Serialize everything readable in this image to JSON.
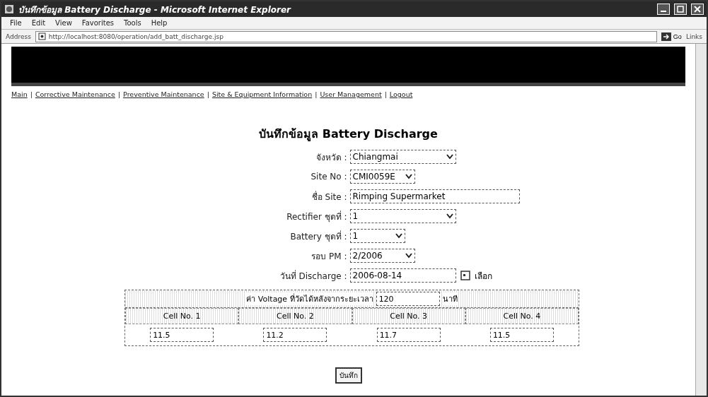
{
  "window": {
    "title": "บันทึกข้อมูล Battery Discharge - Microsoft Internet Explorer"
  },
  "menu": [
    "File",
    "Edit",
    "View",
    "Favorites",
    "Tools",
    "Help"
  ],
  "address": {
    "label": "Address",
    "url": "http://localhost:8080/operation/add_batt_discharge.jsp",
    "go": "Go",
    "links": "Links"
  },
  "nav": [
    {
      "kind": "link",
      "text": "Main"
    },
    {
      "kind": "separator",
      "text": "|"
    },
    {
      "kind": "link",
      "text": "Corrective Maintenance"
    },
    {
      "kind": "separator",
      "text": "|"
    },
    {
      "kind": "link",
      "text": "Preventive Maintenance"
    },
    {
      "kind": "separator",
      "text": "|"
    },
    {
      "kind": "link",
      "text": "Site & Equipment Information"
    },
    {
      "kind": "separator",
      "text": "|"
    },
    {
      "kind": "link",
      "text": "User Management"
    },
    {
      "kind": "separator",
      "text": "|"
    },
    {
      "kind": "link",
      "text": "Logout"
    }
  ],
  "form": {
    "title": "บันทึกข้อมูล Battery Discharge",
    "fields": [
      {
        "kind": "select",
        "label": "จังหวัด :",
        "value": "Chiangmai"
      },
      {
        "kind": "select",
        "label": "Site No :",
        "value": "CMI0059E"
      },
      {
        "kind": "text",
        "label": "ชื่อ Site :",
        "value": "Rimping Supermarket"
      },
      {
        "kind": "select",
        "label": "Rectifier ชุดที่ :",
        "value": "1"
      },
      {
        "kind": "select",
        "label": "Battery ชุดที่ :",
        "value": "1"
      },
      {
        "kind": "select",
        "label": "รอบ PM :",
        "value": "2/2006"
      },
      {
        "kind": "date",
        "label": "วันที่ Discharge :",
        "value": "2006-08-14",
        "button": "เลือก"
      }
    ]
  },
  "voltage": {
    "label": "ค่า Voltage ที่วัดได้หลังจากระยะเวลา",
    "minutes": "120",
    "unit": "นาที",
    "cells": [
      {
        "header": "Cell No. 1",
        "value": "11.5"
      },
      {
        "header": "Cell No. 2",
        "value": "11.2"
      },
      {
        "header": "Cell No. 3",
        "value": "11.7"
      },
      {
        "header": "Cell No. 4",
        "value": "11.5"
      }
    ]
  },
  "save_button": "บันทึก"
}
